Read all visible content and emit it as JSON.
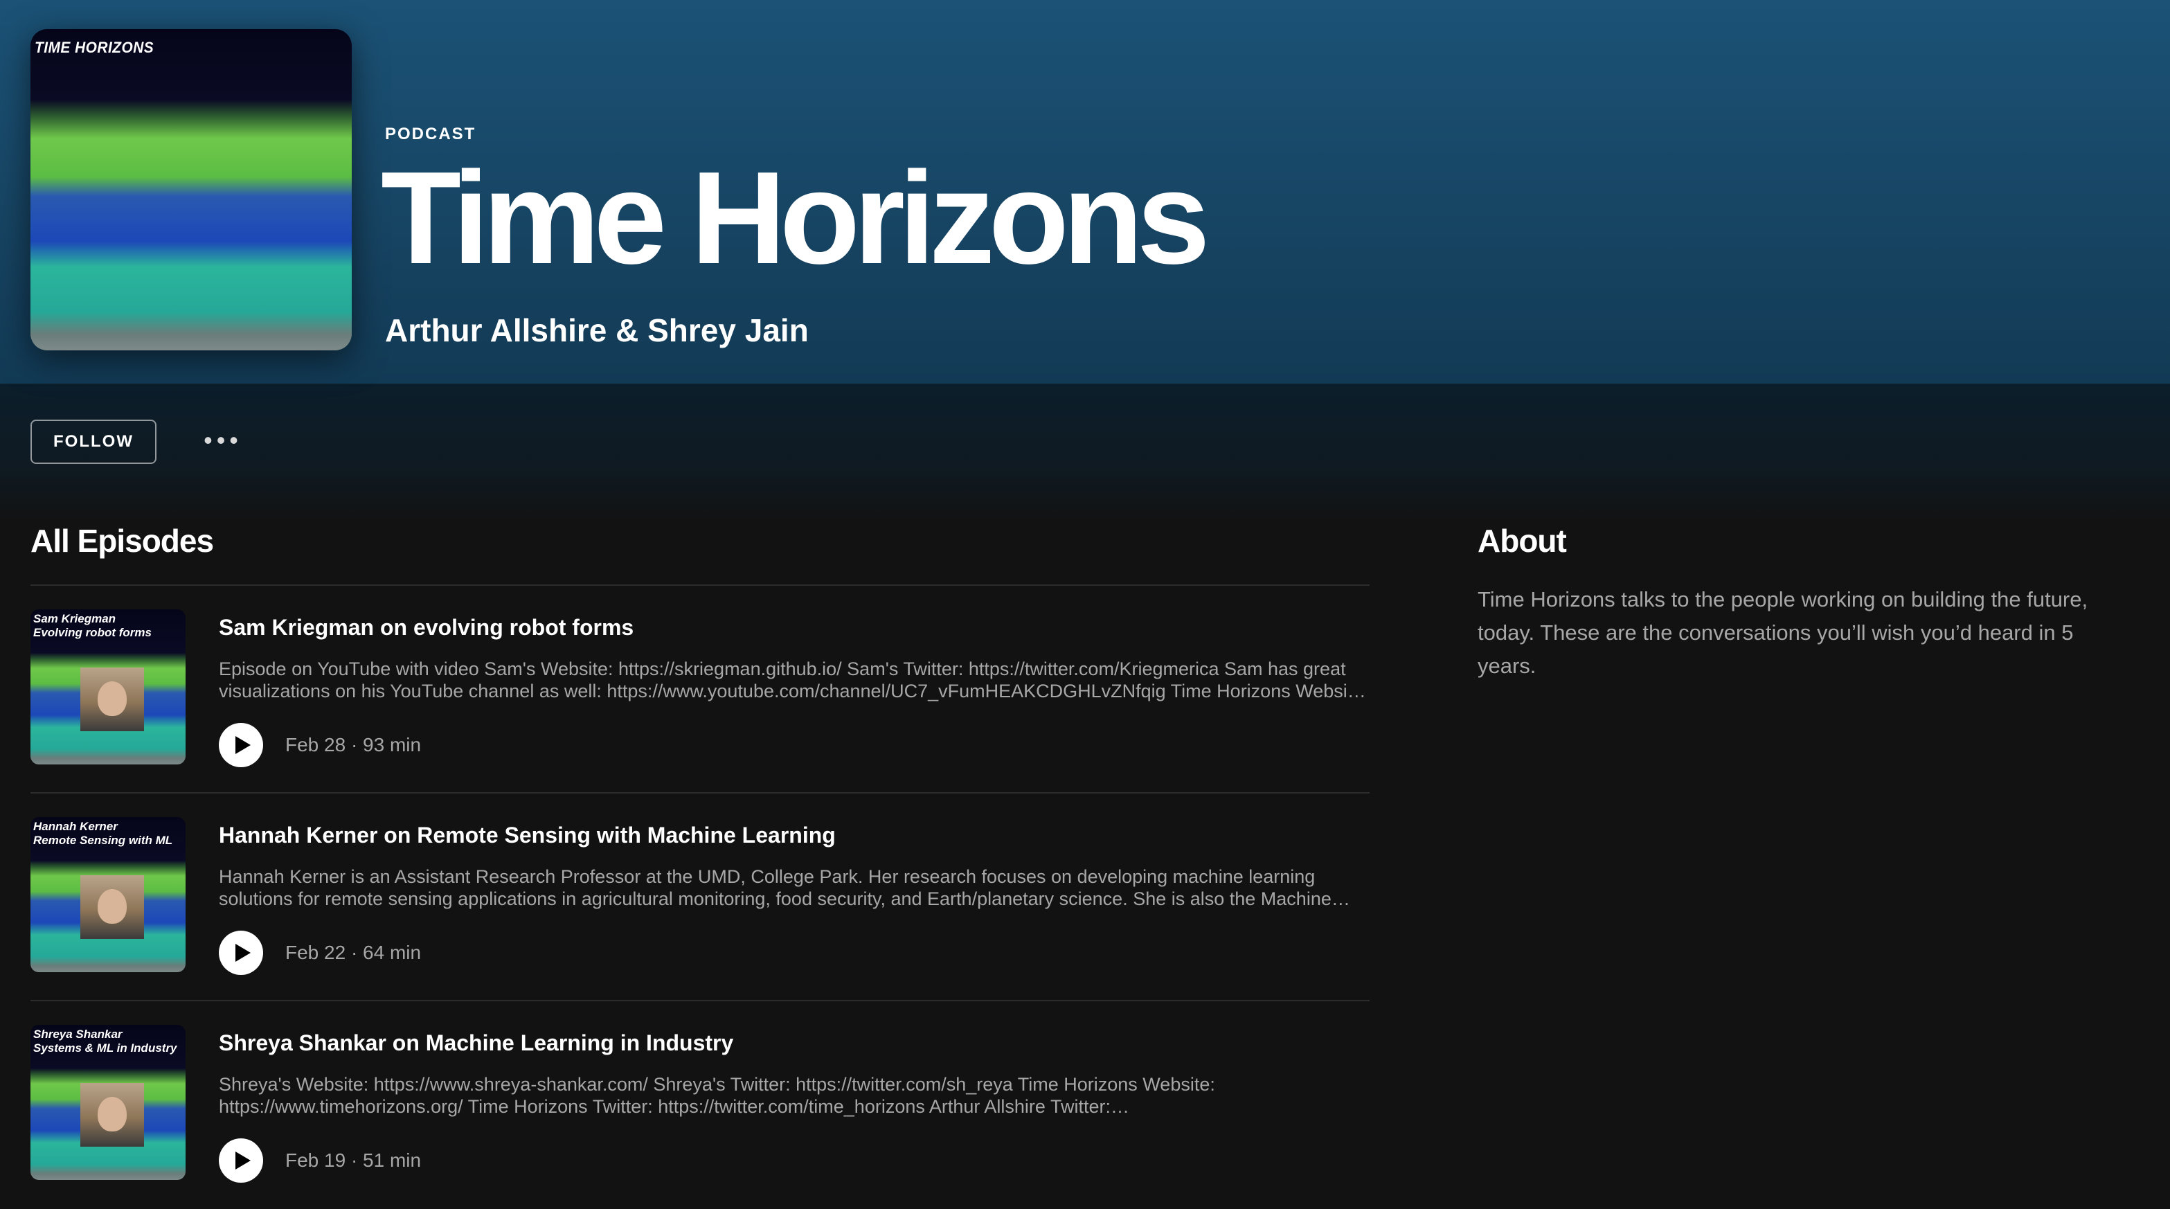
{
  "header": {
    "cover_label": "TIME HORIZONS",
    "type_label": "PODCAST",
    "title": "Time Horizons",
    "author": "Arthur Allshire & Shrey Jain",
    "gradient_color": "#1b5276"
  },
  "actions": {
    "follow_label": "FOLLOW",
    "more_label": "•••"
  },
  "episodes_section": {
    "title": "All Episodes",
    "episodes": [
      {
        "thumb_text": "Sam Kriegman\nEvolving robot forms",
        "title": "Sam Kriegman on evolving robot forms",
        "description": "Episode on YouTube with video Sam's Website: https://skriegman.github.io/ Sam's Twitter: https://twitter.com/Kriegmerica Sam has great visualizations on his YouTube channel as well: https://www.youtube.com/channel/UC7_vFumHEAKCDGHLvZNfqig Time Horizons Website: https://www.timehorizons.org/",
        "meta": "Feb 28 · 93 min"
      },
      {
        "thumb_text": "Hannah Kerner\nRemote Sensing with ML",
        "title": "Hannah Kerner on Remote Sensing with Machine Learning",
        "description": "Hannah Kerner is an Assistant Research Professor at the UMD, College Park. Her research focuses on developing machine learning solutions for remote sensing applications in agricultural monitoring, food security, and Earth/planetary science. She is also the Machine Learning Lead for NASA Harvest.",
        "meta": "Feb 22 · 64 min"
      },
      {
        "thumb_text": "Shreya Shankar\nSystems & ML in Industry",
        "title": "Shreya Shankar on Machine Learning in Industry",
        "description": "Shreya's Website: https://www.shreya-shankar.com/ Shreya's Twitter: https://twitter.com/sh_reya Time Horizons Website: https://www.timehorizons.org/ Time Horizons Twitter: https://twitter.com/time_horizons Arthur Allshire Twitter: https://twitter.com/arthurallshire",
        "meta": "Feb 19 · 51 min"
      }
    ]
  },
  "about": {
    "title": "About",
    "text": "Time Horizons talks to the people working on building the future, today. These are the conversations you’ll wish you’d heard in 5 years."
  }
}
